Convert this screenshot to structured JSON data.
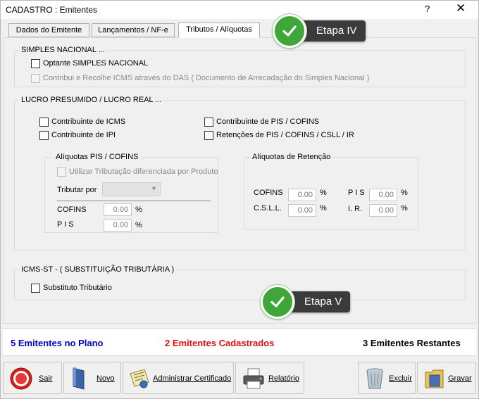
{
  "window": {
    "title": "CADASTRO : Emitentes",
    "help_label": "?",
    "close_label": "✕"
  },
  "tabs": [
    {
      "label": "Dados do Emitente"
    },
    {
      "label": "Lançamentos / NF-e"
    },
    {
      "label": "Tributos / Alíquotas",
      "active": true
    }
  ],
  "simples": {
    "legend": "SIMPLES NACIONAL  ...",
    "optante_label": "Optante SIMPLES NACIONAL",
    "recolhe_label": "Contribui e Recolhe ICMS através do DAS ( Documento de Arrecadação do Simples Nacional )"
  },
  "lucro": {
    "legend": "LUCRO PRESUMIDO / LUCRO REAL  ...",
    "icms_label": "Contribuinte de ICMS",
    "ipi_label": "Contribuinte de IPI",
    "pis_cofins_label": "Contribuinte de PIS / COFINS",
    "retencoes_label": "Retenções de PIS / COFINS / CSLL / IR",
    "aliq_pis_cofins": {
      "legend": "Alíquotas PIS / COFINS",
      "diferenciada_label": "Utilizar Tributação diferenciada por Produto",
      "tributar_por_label": "Tributar por",
      "cofins_label": "COFINS",
      "cofins_value": "0.00",
      "pis_label": "P I S",
      "pis_value": "0.00",
      "pct": "%"
    },
    "aliq_retencao": {
      "legend": "Alíquotas de Retenção",
      "cofins_label": "COFINS",
      "cofins_value": "0.00",
      "csll_label": "C.S.L.L.",
      "csll_value": "0.00",
      "pis_label": "P I S",
      "pis_value": "0.00",
      "ir_label": "I. R.",
      "ir_value": "0.00",
      "pct": "%"
    }
  },
  "icms_st": {
    "legend": "ICMS-ST -  ( SUBSTITUIÇÃO TRIBUTÁRIA )",
    "substituto_label": "Substituto Tributário"
  },
  "annotations": {
    "etapa_iv": "Etapa IV",
    "etapa_v": "Etapa V",
    "accent_green": "#3fa63a",
    "badge_bg": "#3b3b3b"
  },
  "status": {
    "plano": "5 Emitentes no Plano",
    "plano_color": "#0000cc",
    "cadastrados": "2 Emitentes Cadastrados",
    "cadastrados_color": "#e01010",
    "restantes": "3 Emitentes Restantes"
  },
  "buttons": {
    "sair": "Sair",
    "novo": "Novo",
    "certificado": "Administrar Certificado",
    "relatorio": "Relatório",
    "excluir": "Excluir",
    "gravar": "Gravar"
  }
}
